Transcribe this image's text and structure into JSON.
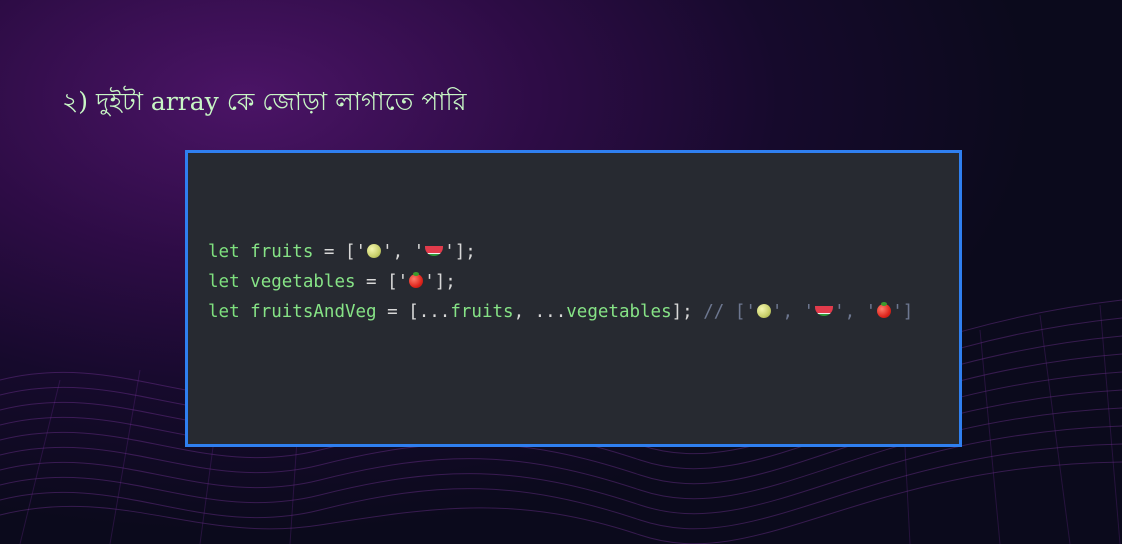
{
  "slide": {
    "title": "২) দুইটা array কে জোড়া লাগাতে পারি"
  },
  "code": {
    "lines": [
      {
        "tokens": [
          {
            "text": "let ",
            "type": "keyword"
          },
          {
            "text": "fruits",
            "type": "identifier"
          },
          {
            "text": " = ['",
            "type": "operator"
          },
          {
            "emoji": "melon-icon"
          },
          {
            "text": "', '",
            "type": "operator"
          },
          {
            "emoji": "watermelon-icon"
          },
          {
            "text": "'];",
            "type": "operator"
          }
        ]
      },
      {
        "tokens": [
          {
            "text": "let ",
            "type": "keyword"
          },
          {
            "text": "vegetables",
            "type": "identifier"
          },
          {
            "text": " = ['",
            "type": "operator"
          },
          {
            "emoji": "tomato-icon"
          },
          {
            "text": "'];",
            "type": "operator"
          }
        ]
      },
      {
        "tokens": [
          {
            "text": "let ",
            "type": "keyword"
          },
          {
            "text": "fruitsAndVeg",
            "type": "identifier"
          },
          {
            "text": " = [...",
            "type": "operator"
          },
          {
            "text": "fruits",
            "type": "identifier"
          },
          {
            "text": ", ...",
            "type": "operator"
          },
          {
            "text": "vegetables",
            "type": "identifier"
          },
          {
            "text": "]; ",
            "type": "operator"
          },
          {
            "text": "// ['",
            "type": "comment"
          },
          {
            "emoji": "melon-icon"
          },
          {
            "text": "', '",
            "type": "comment"
          },
          {
            "emoji": "watermelon-icon"
          },
          {
            "text": "', '",
            "type": "comment"
          },
          {
            "emoji": "tomato-icon"
          },
          {
            "text": "']",
            "type": "comment"
          }
        ]
      }
    ]
  },
  "colors": {
    "title": "#c8f7c5",
    "panel_bg": "#272a31",
    "panel_border": "#2f7ff0",
    "keyword": "#7ee07e",
    "comment": "#6d7790"
  }
}
